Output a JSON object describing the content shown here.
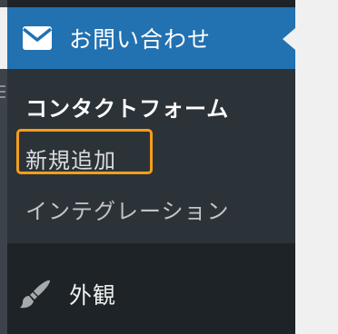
{
  "menu": {
    "contact": {
      "icon": "mail-icon",
      "label": "お問い合わせ",
      "submenu": [
        {
          "label": "コンタクトフォーム",
          "current": true
        },
        {
          "label": "新規追加",
          "highlighted": true
        },
        {
          "label": "インテグレーション"
        }
      ]
    },
    "appearance": {
      "icon": "paintbrush-icon",
      "label": "外観"
    }
  },
  "colors": {
    "active_bg": "#2271b1",
    "sidebar_bg": "#1d2327",
    "submenu_bg": "#2c3338",
    "highlight": "#f59e1b"
  }
}
